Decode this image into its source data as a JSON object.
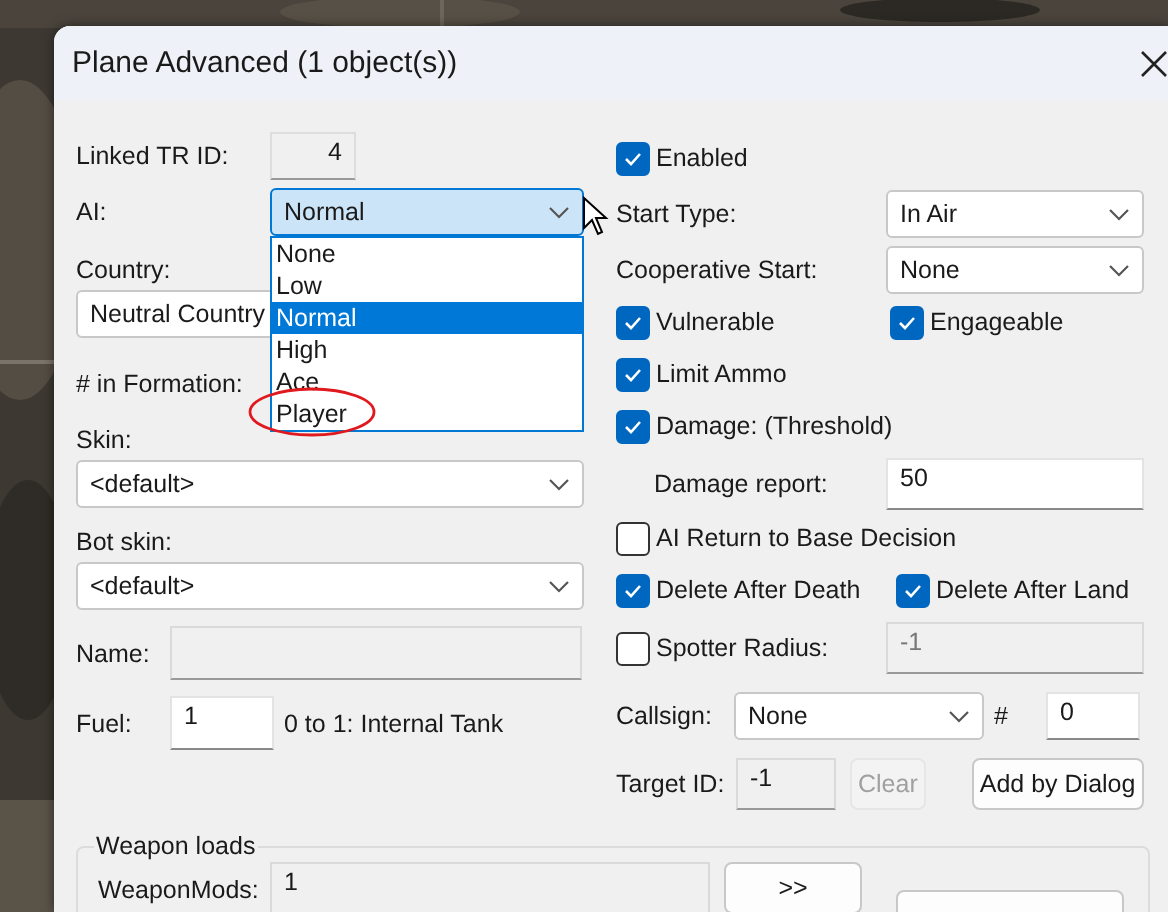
{
  "window": {
    "title": "Plane Advanced (1 object(s))"
  },
  "left_fields": [
    {
      "kind": "number",
      "label": "Linked TR ID:",
      "value": "4"
    },
    {
      "kind": "combo",
      "label": "AI:",
      "value": "Normal",
      "open": true,
      "options": [
        {
          "label": "None",
          "selected": false,
          "circled": false
        },
        {
          "label": "Low",
          "selected": false,
          "circled": false
        },
        {
          "label": "Normal",
          "selected": true,
          "circled": false
        },
        {
          "label": "High",
          "selected": false,
          "circled": false
        },
        {
          "label": "Ace",
          "selected": false,
          "circled": false
        },
        {
          "label": "Player",
          "selected": false,
          "circled": true
        }
      ]
    },
    {
      "kind": "combo_below",
      "label": "Country:",
      "value": "Neutral Country",
      "arrow": false
    },
    {
      "kind": "label",
      "label": "# in Formation:"
    },
    {
      "kind": "combo_below",
      "label": "Skin:",
      "value": "<default>",
      "arrow": true
    },
    {
      "kind": "combo_below",
      "label": "Bot skin:",
      "value": "<default>",
      "arrow": true
    },
    {
      "kind": "text",
      "label": "Name:",
      "disabled": true
    },
    {
      "kind": "text",
      "label": "Fuel:",
      "value": "1",
      "disabled": false,
      "note": "0 to 1: Internal Tank"
    }
  ],
  "right_fields": [
    {
      "kind": "check",
      "label": "Enabled",
      "checked": true
    },
    {
      "kind": "combo",
      "label": "Start Type:",
      "value": "In Air"
    },
    {
      "kind": "combo",
      "label": "Cooperative Start:",
      "value": "None"
    },
    {
      "kind": "check_pair",
      "items": [
        {
          "label": "Vulnerable",
          "checked": true
        },
        {
          "label": "Engageable",
          "checked": true
        }
      ]
    },
    {
      "kind": "check",
      "label": "Limit Ammo",
      "checked": true
    },
    {
      "kind": "check",
      "label": "Damage: (Threshold)",
      "checked": true
    },
    {
      "kind": "field",
      "label": "Damage report:",
      "value": "50",
      "disabled": false
    },
    {
      "kind": "check",
      "label": "AI Return to Base Decision",
      "checked": false
    },
    {
      "kind": "check_pair",
      "items": [
        {
          "label": "Delete After Death",
          "checked": true
        },
        {
          "label": "Delete After Land",
          "checked": true
        }
      ]
    },
    {
      "kind": "check_field",
      "label": "Spotter Radius:",
      "checked": false,
      "value": "-1",
      "disabled": true
    },
    {
      "kind": "callsign",
      "label": "Callsign:",
      "value": "None",
      "hash": "#",
      "number": "0"
    },
    {
      "kind": "target",
      "label": "Target ID:",
      "value": "-1",
      "buttons": [
        {
          "label": "Clear",
          "disabled": true
        },
        {
          "label": "Add by Dialog",
          "disabled": false
        }
      ]
    }
  ],
  "weapon_loads": {
    "title": "Weapon loads",
    "label": "WeaponMods:",
    "value": "1",
    "button": ">>"
  }
}
